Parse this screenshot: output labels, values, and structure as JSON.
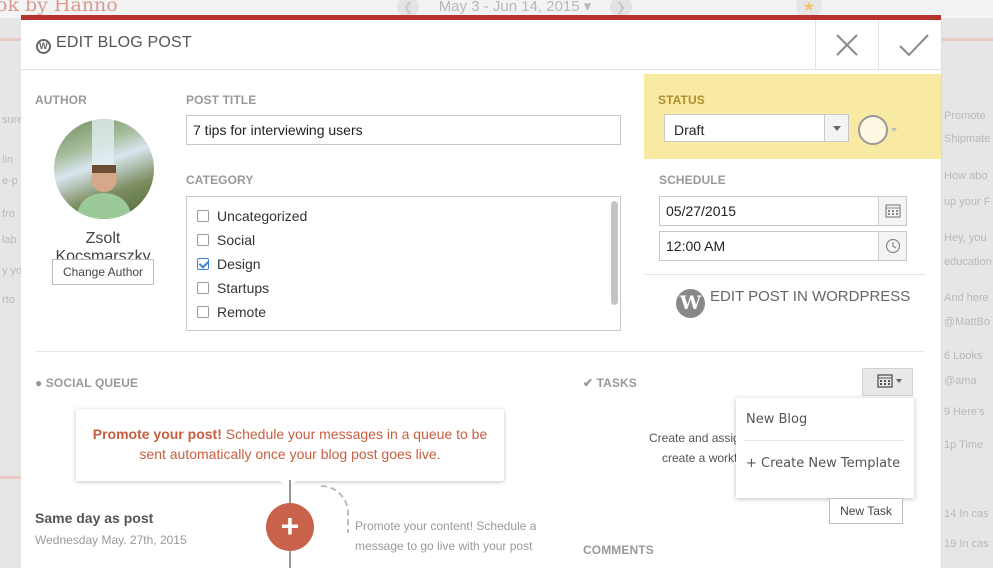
{
  "background": {
    "brand": "ok by Hanno",
    "date_range": "May 3 - Jun 14, 2015",
    "left_fragments": [
      "sure",
      "lin",
      "e-p",
      "fro",
      "lab",
      "y yo",
      "rto"
    ],
    "right_fragments": [
      "Promote",
      "Shipmate",
      "How abo",
      "up your F",
      "Hey, you",
      "education",
      "And here",
      "@MattBo",
      "6 Looks",
      "@ama",
      "9 Here's",
      "1p Time",
      "14 In cas",
      "19 In cas"
    ]
  },
  "modal": {
    "title": "EDIT BLOG POST",
    "author": {
      "label": "AUTHOR",
      "name": "Zsolt Kocsmarszky",
      "change_button": "Change Author"
    },
    "post_title": {
      "label": "POST TITLE",
      "value": "7 tips for interviewing users"
    },
    "category": {
      "label": "CATEGORY",
      "items": [
        {
          "label": "Uncategorized",
          "checked": false
        },
        {
          "label": "Social",
          "checked": false
        },
        {
          "label": "Design",
          "checked": true
        },
        {
          "label": "Startups",
          "checked": false
        },
        {
          "label": "Remote",
          "checked": false
        }
      ]
    },
    "status": {
      "label": "STATUS",
      "value": "Draft"
    },
    "schedule": {
      "label": "SCHEDULE",
      "date": "05/27/2015",
      "time": "12:00 AM"
    },
    "edit_in_wordpress": "EDIT POST IN WORDPRESS",
    "social_queue": {
      "label": "SOCIAL QUEUE",
      "callout_bold": "Promote your post!",
      "callout_rest_line1": "Schedule your messages in a queue to be",
      "callout_line2": "sent automatically once your blog post goes live.",
      "timeline_title": "Same day as post",
      "timeline_date": "Wednesday May. 27th, 2015",
      "hint_line1": "Promote your content! Schedule a",
      "hint_line2": "message to go live with your post"
    },
    "tasks": {
      "label": "TASKS",
      "empty_line1": "Create and assig",
      "empty_line2": "create a workf",
      "new_task_button": "New Task",
      "menu": {
        "items": [
          "New Blog",
          "+ Create New Template"
        ]
      }
    },
    "comments": {
      "label": "COMMENTS"
    }
  },
  "colors": {
    "accent_red": "#b7312f",
    "status_yellow": "#f9eaa3",
    "promote_orange": "#c75e3f",
    "plus_button": "#c9624a",
    "checkbox_blue": "#3b82d6"
  }
}
